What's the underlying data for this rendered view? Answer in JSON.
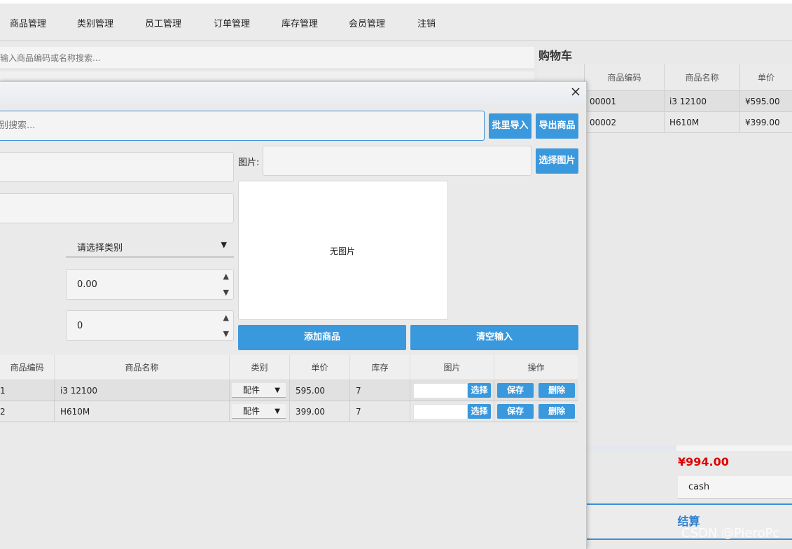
{
  "menu": [
    "商品管理",
    "类别管理",
    "员工管理",
    "订单管理",
    "库存管理",
    "会员管理",
    "注销"
  ],
  "bg_search_placeholder": "输入商品编码或名称搜索...",
  "cart": {
    "title": "购物车",
    "headers": [
      "",
      "商品编码",
      "商品名称",
      "单价"
    ],
    "rows": [
      {
        "code": "00001",
        "name": "i3 12100",
        "price": "¥595.00"
      },
      {
        "code": "00002",
        "name": "H610M",
        "price": "¥399.00"
      }
    ],
    "total": "¥994.00",
    "payment_method": "cash",
    "checkout_label": "结算"
  },
  "dialog": {
    "search_placeholder": "别搜索...",
    "batch_import": "批里导入",
    "export_goods": "导出商品",
    "image_label": "图片:",
    "choose_image": "选择图片",
    "no_image": "无图片",
    "category_placeholder": "请选择类别",
    "price_value": "0.00",
    "stock_value": "0",
    "add_goods": "添加商品",
    "clear_input": "清空输入",
    "table": {
      "headers": [
        "商品编码",
        "商品名称",
        "类别",
        "单价",
        "库存",
        "图片",
        "操作"
      ],
      "rows": [
        {
          "code": "1",
          "name": "i3 12100",
          "category": "配件",
          "price": "595.00",
          "stock": "7"
        },
        {
          "code": "2",
          "name": "H610M",
          "category": "配件",
          "price": "399.00",
          "stock": "7"
        }
      ],
      "select_label": "选择",
      "save_label": "保存",
      "delete_label": "删除"
    }
  },
  "watermark": "CSDN @PieroPc",
  "colors": {
    "accent": "#3a98dc",
    "total": "#e00000"
  }
}
